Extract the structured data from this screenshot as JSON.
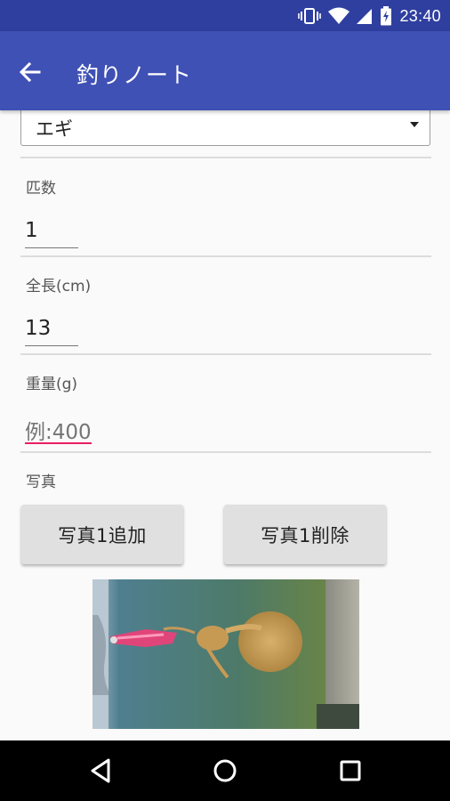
{
  "status_bar": {
    "time": "23:40",
    "icons": [
      "vibrate-icon",
      "wifi-icon",
      "signal-icon",
      "battery-charging-icon"
    ]
  },
  "app_bar": {
    "title": "釣りノート",
    "back_icon": "arrow-back-icon"
  },
  "form": {
    "bait_select": {
      "value": "エギ"
    },
    "count": {
      "label": "匹数",
      "value": "1"
    },
    "length": {
      "label": "全長(cm)",
      "value": "13"
    },
    "weight": {
      "label": "重量(g)",
      "placeholder": "例:400"
    },
    "photo": {
      "label": "写真"
    }
  },
  "buttons": {
    "add_photo": "写真1追加",
    "delete_photo": "写真1削除"
  },
  "photo_image": "squid-catch-photo",
  "nav": {
    "icons": [
      "back-triangle-icon",
      "home-circle-icon",
      "recents-square-icon"
    ]
  },
  "colors": {
    "app_bar": "#3f51b5",
    "status_bar": "#2f3f9f",
    "error_underline": "#e91e63"
  }
}
